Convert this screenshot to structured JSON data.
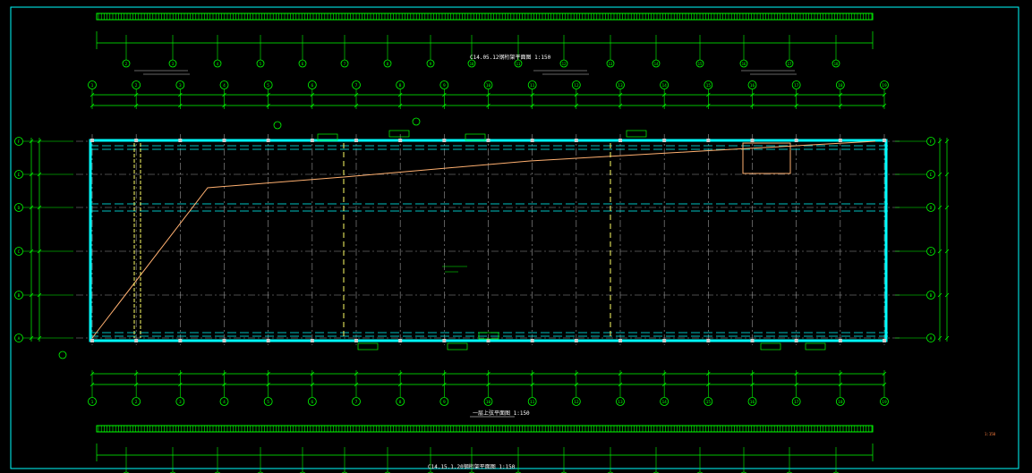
{
  "drawing": {
    "title_main": "一层上弦平面图 1:150",
    "title_top_strip": "C14.05.12钢桁架平面图 1:150",
    "title_bottom_strip": "C14.15.1.20钢桁架平面图 1:150",
    "corner_note": "1:150"
  },
  "grid": {
    "columns": [
      "1",
      "2",
      "3",
      "4",
      "5",
      "6",
      "7",
      "8",
      "9",
      "10",
      "11",
      "12",
      "13",
      "14",
      "15",
      "16",
      "17",
      "18",
      "19"
    ],
    "rows": [
      "A",
      "B",
      "C",
      "D",
      "E",
      "F"
    ]
  },
  "colors": {
    "background": "#000000",
    "frame": "#00ffff",
    "grid_line": "#9a9a9a",
    "dimension": "#00ff00",
    "annotation": "#ffff66",
    "pipe": "#ffb070",
    "text": "#ffffff"
  }
}
